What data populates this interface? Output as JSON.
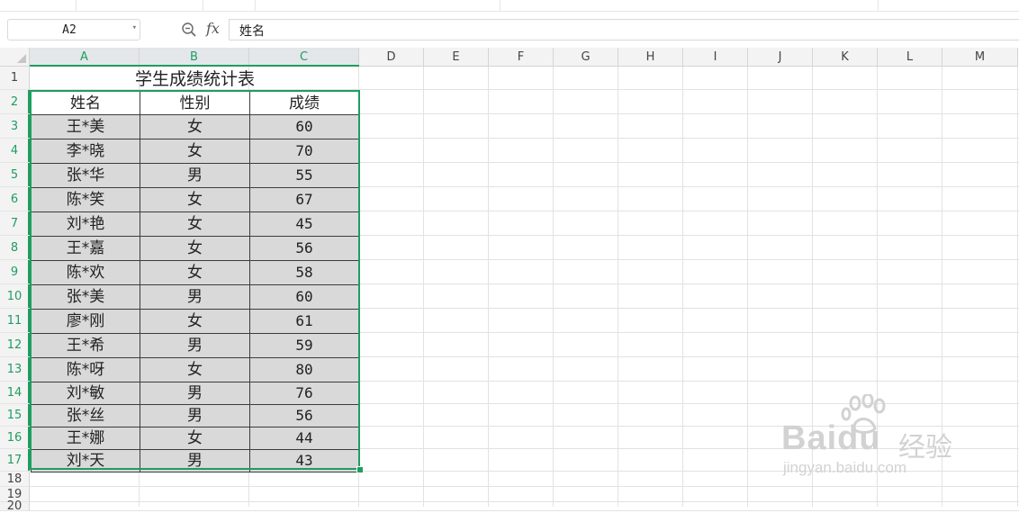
{
  "name_box": {
    "value": "A2"
  },
  "formula_bar": {
    "fx_label": "fx",
    "content": "姓名"
  },
  "columns": [
    "A",
    "B",
    "C",
    "D",
    "E",
    "F",
    "G",
    "H",
    "I",
    "J",
    "K",
    "L",
    "M"
  ],
  "rows": [
    "1",
    "2",
    "3",
    "4",
    "5",
    "6",
    "7",
    "8",
    "9",
    "10",
    "11",
    "12",
    "13",
    "14",
    "15",
    "16",
    "17",
    "18",
    "19",
    "20"
  ],
  "sheet": {
    "title": "学生成绩统计表",
    "headers": [
      "姓名",
      "性别",
      "成绩"
    ],
    "records": [
      [
        "王*美",
        "女",
        "60"
      ],
      [
        "李*晓",
        "女",
        "70"
      ],
      [
        "张*华",
        "男",
        "55"
      ],
      [
        "陈*笑",
        "女",
        "67"
      ],
      [
        "刘*艳",
        "女",
        "45"
      ],
      [
        "王*嘉",
        "女",
        "56"
      ],
      [
        "陈*欢",
        "女",
        "58"
      ],
      [
        "张*美",
        "男",
        "60"
      ],
      [
        "廖*刚",
        "女",
        "61"
      ],
      [
        "王*希",
        "男",
        "59"
      ],
      [
        "陈*呀",
        "女",
        "80"
      ],
      [
        "刘*敏",
        "男",
        "76"
      ],
      [
        "张*丝",
        "男",
        "56"
      ],
      [
        "王*娜",
        "女",
        "44"
      ],
      [
        "刘*天",
        "男",
        "43"
      ]
    ]
  },
  "watermark": {
    "brand": "Bai",
    "brand2": "du",
    "cn": "经验",
    "url": "jingyan.baidu.com"
  },
  "colors": {
    "selection": "#1f9d61",
    "cell_fill": "#d9d9d9"
  }
}
